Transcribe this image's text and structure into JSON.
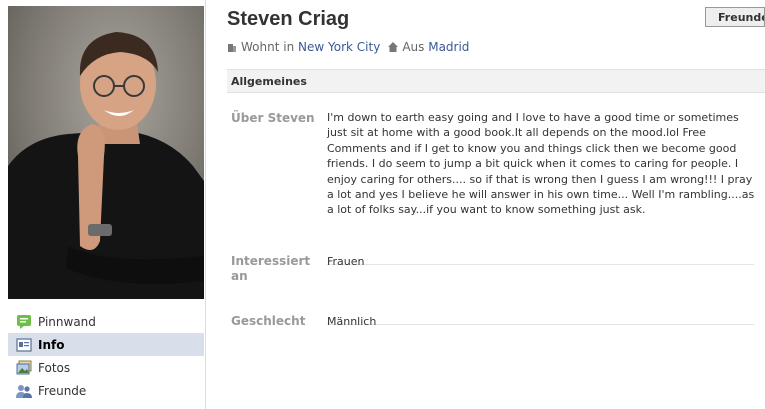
{
  "profile": {
    "name": "Steven Criag",
    "friend_button": "Freunde",
    "lives_prefix": "Wohnt in",
    "lives_city": "New York City",
    "from_prefix": "Aus",
    "from_city": "Madrid"
  },
  "nav": {
    "items": [
      {
        "label": "Pinnwand",
        "icon": "wall-icon"
      },
      {
        "label": "Info",
        "icon": "info-icon"
      },
      {
        "label": "Fotos",
        "icon": "photos-icon"
      },
      {
        "label": "Freunde",
        "icon": "friends-icon"
      }
    ],
    "active": "Info"
  },
  "info": {
    "section_title": "Allgemeines",
    "about_label": "Über Steven",
    "about_text": "I'm down to earth easy going and I love to have a good time or sometimes just sit at home with a good book.It all depends on the mood.lol Free Comments and if I get to know you and things click then we become good friends. I do seem to jump a bit quick when it comes to caring for people. I enjoy caring for others.... so if that is wrong then I guess I am wrong!!! I pray a lot and yes I believe he will answer in his own time... Well I'm rambling....as a lot of folks say...if you want to know something just ask.",
    "interested_label": "Interessiert an",
    "interested_value": "Frauen",
    "gender_label": "Geschlecht",
    "gender_value": "Männlich"
  },
  "colors": {
    "link": "#3b5998",
    "nav_active": "#d8dfea"
  }
}
